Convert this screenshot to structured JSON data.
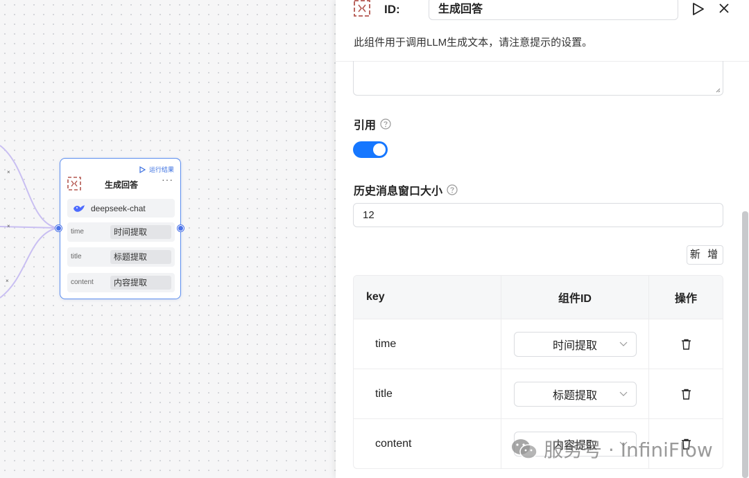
{
  "canvas": {
    "node": {
      "run_label": "运行结果",
      "title": "生成回答",
      "more": "···",
      "model": "deepseek-chat",
      "params": [
        {
          "key": "time",
          "value": "时间提取"
        },
        {
          "key": "title",
          "value": "标题提取"
        },
        {
          "key": "content",
          "value": "内容提取"
        }
      ]
    },
    "edge_marks": [
      "×",
      "×",
      "×"
    ]
  },
  "panel": {
    "id_label": "ID:",
    "id_value": "生成回答",
    "description": "此组件用于调用LLM生成文本，请注意提示的设置。",
    "quote_label": "引用",
    "quote_enabled": true,
    "history_label": "历史消息窗口大小",
    "history_value": "12",
    "add_button": "新 增",
    "table": {
      "headers": [
        "key",
        "组件ID",
        "操作"
      ],
      "rows": [
        {
          "key": "time",
          "component": "时间提取"
        },
        {
          "key": "title",
          "component": "标题提取"
        },
        {
          "key": "content",
          "component": "内容提取"
        }
      ]
    },
    "accent_color": "#1677ff"
  },
  "watermark": {
    "text": "服务号 · InfiniFlow"
  }
}
